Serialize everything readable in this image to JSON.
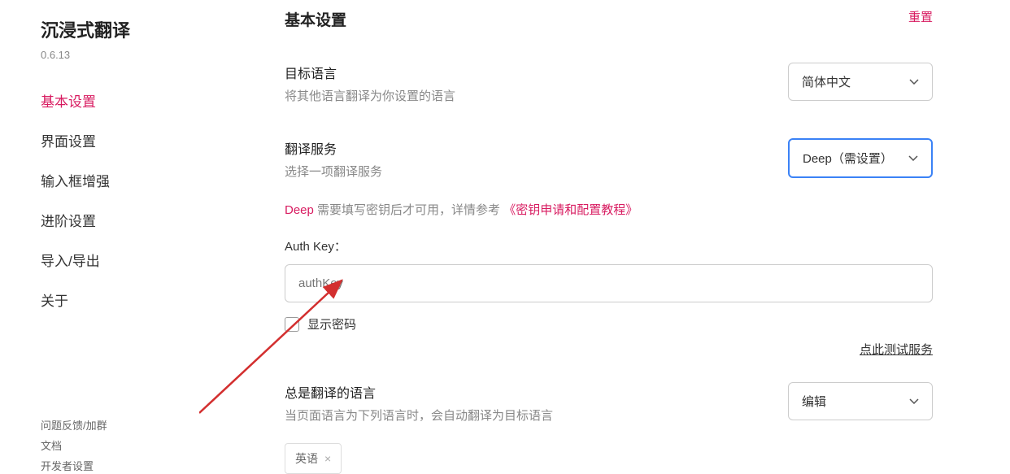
{
  "sidebar": {
    "title": "沉浸式翻译",
    "version": "0.6.13",
    "nav": [
      {
        "label": "基本设置",
        "active": true
      },
      {
        "label": "界面设置",
        "active": false
      },
      {
        "label": "输入框增强",
        "active": false
      },
      {
        "label": "进阶设置",
        "active": false
      },
      {
        "label": "导入/导出",
        "active": false
      },
      {
        "label": "关于",
        "active": false
      }
    ],
    "footer": [
      "问题反馈/加群",
      "文档",
      "开发者设置"
    ]
  },
  "main": {
    "page_title": "基本设置",
    "reset": "重置",
    "target_lang": {
      "title": "目标语言",
      "desc": "将其他语言翻译为你设置的语言",
      "value": "简体中文"
    },
    "service": {
      "title": "翻译服务",
      "desc": "选择一项翻译服务",
      "value": "Deep（需设置）"
    },
    "service_info": {
      "brand": "Deep",
      "text": " 需要填写密钥后才可用，详情参考 ",
      "link": "《密钥申请和配置教程》"
    },
    "auth_key": {
      "label": "Auth Key：",
      "placeholder": "authKey"
    },
    "show_password": "显示密码",
    "test_service": "点此测试服务",
    "always_translate": {
      "title": "总是翻译的语言",
      "desc": "当页面语言为下列语言时，会自动翻译为目标语言",
      "value": "编辑"
    },
    "tag": {
      "label": "英语",
      "close": "×"
    }
  }
}
